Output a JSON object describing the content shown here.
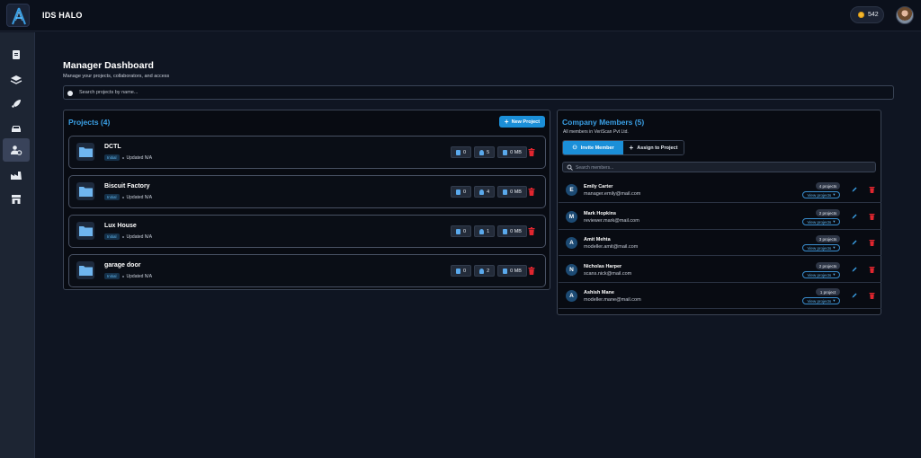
{
  "app": {
    "title": "IDS HALO",
    "credits": "542"
  },
  "sidebar": {
    "items": [
      {
        "icon": "document-icon",
        "active": false
      },
      {
        "icon": "layers-icon",
        "active": false
      },
      {
        "icon": "rocket-icon",
        "active": false
      },
      {
        "icon": "car-icon",
        "active": false
      },
      {
        "icon": "user-settings-icon",
        "active": true
      },
      {
        "icon": "factory-icon",
        "active": false
      },
      {
        "icon": "store-icon",
        "active": false
      }
    ]
  },
  "page": {
    "title": "Manager Dashboard",
    "subtitle": "Manage your projects, collaborators, and access",
    "search_placeholder": "Search projects by name..."
  },
  "projects": {
    "title": "Projects (4)",
    "new_button": "New Project",
    "items": [
      {
        "name": "DCTL",
        "status": "Initial",
        "updated": "Updated N/A",
        "files": "0",
        "users": "5",
        "size": "0 MB"
      },
      {
        "name": "Biscuit Factory",
        "status": "Initial",
        "updated": "Updated N/A",
        "files": "0",
        "users": "4",
        "size": "0 MB"
      },
      {
        "name": "Lux House",
        "status": "Initial",
        "updated": "Updated N/A",
        "files": "0",
        "users": "1",
        "size": "0 MB"
      },
      {
        "name": "garage door",
        "status": "Initial",
        "updated": "Updated N/A",
        "files": "0",
        "users": "2",
        "size": "0 MB"
      }
    ]
  },
  "members": {
    "title": "Company Members (5)",
    "subtitle": "All members in VeriScan Pvt Ltd.",
    "tabs": {
      "invite": "Invite Member",
      "assign": "Assign to Project"
    },
    "search_placeholder": "Search members...",
    "view_label": "View projects",
    "items": [
      {
        "initial": "E",
        "name": "Emily Carter",
        "email": "manager.emily@mail.com",
        "count": "4 projects"
      },
      {
        "initial": "M",
        "name": "Mark Hopkins",
        "email": "reviewer.mark@mail.com",
        "count": "2 projects"
      },
      {
        "initial": "A",
        "name": "Amit Mehta",
        "email": "modeller.amit@mail.com",
        "count": "3 projects"
      },
      {
        "initial": "N",
        "name": "Nicholas Harper",
        "email": "scans.nick@mail.com",
        "count": "2 projects"
      },
      {
        "initial": "A",
        "name": "Ashish Mane",
        "email": "modeller.mane@mail.com",
        "count": "1 project"
      }
    ]
  },
  "colors": {
    "accent": "#1b8fd8",
    "danger": "#e0262f",
    "background": "#0f1522"
  }
}
